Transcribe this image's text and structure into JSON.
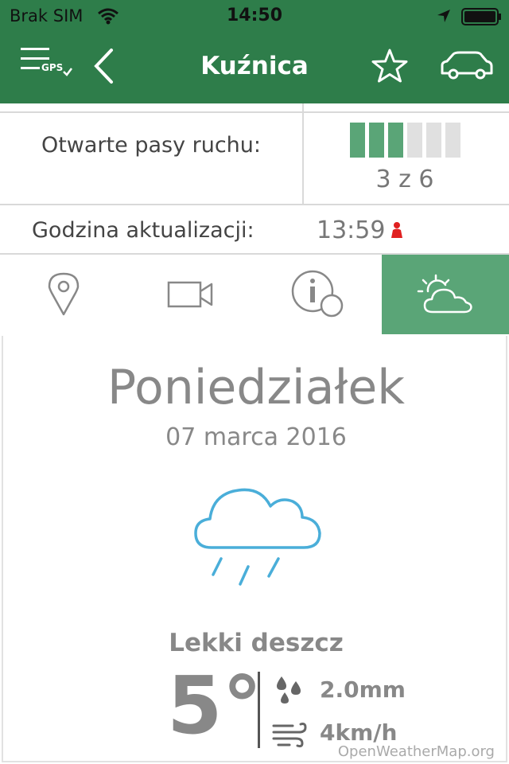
{
  "status_bar": {
    "carrier": "Brak SIM",
    "time": "14:50"
  },
  "nav": {
    "menu_badge": "GPS",
    "title": "Kuźnica"
  },
  "lanes": {
    "label": "Otwarte pasy ruchu:",
    "open": 3,
    "total": 6,
    "count_text": "3 z 6"
  },
  "update": {
    "label": "Godzina aktualizacji:",
    "value": "13:59"
  },
  "tabs": [
    {
      "name": "location",
      "icon": "map-pin-icon",
      "active": false
    },
    {
      "name": "camera",
      "icon": "video-camera-icon",
      "active": false
    },
    {
      "name": "info",
      "icon": "info-icon",
      "active": false
    },
    {
      "name": "weather",
      "icon": "weather-partly-cloudy-icon",
      "active": true
    }
  ],
  "weather": {
    "day": "Poniedziałek",
    "date": "07 marca 2016",
    "condition_icon": "rain-cloud-icon",
    "description": "Lekki deszcz",
    "temperature": "5°",
    "precipitation": "2.0mm",
    "wind": "4km/h",
    "credit": "OpenWeatherMap.org"
  },
  "colors": {
    "brand_green": "#2e7d4a",
    "accent_green": "#5aa577",
    "rain_blue": "#4aaed9",
    "alert_red": "#e02020"
  }
}
